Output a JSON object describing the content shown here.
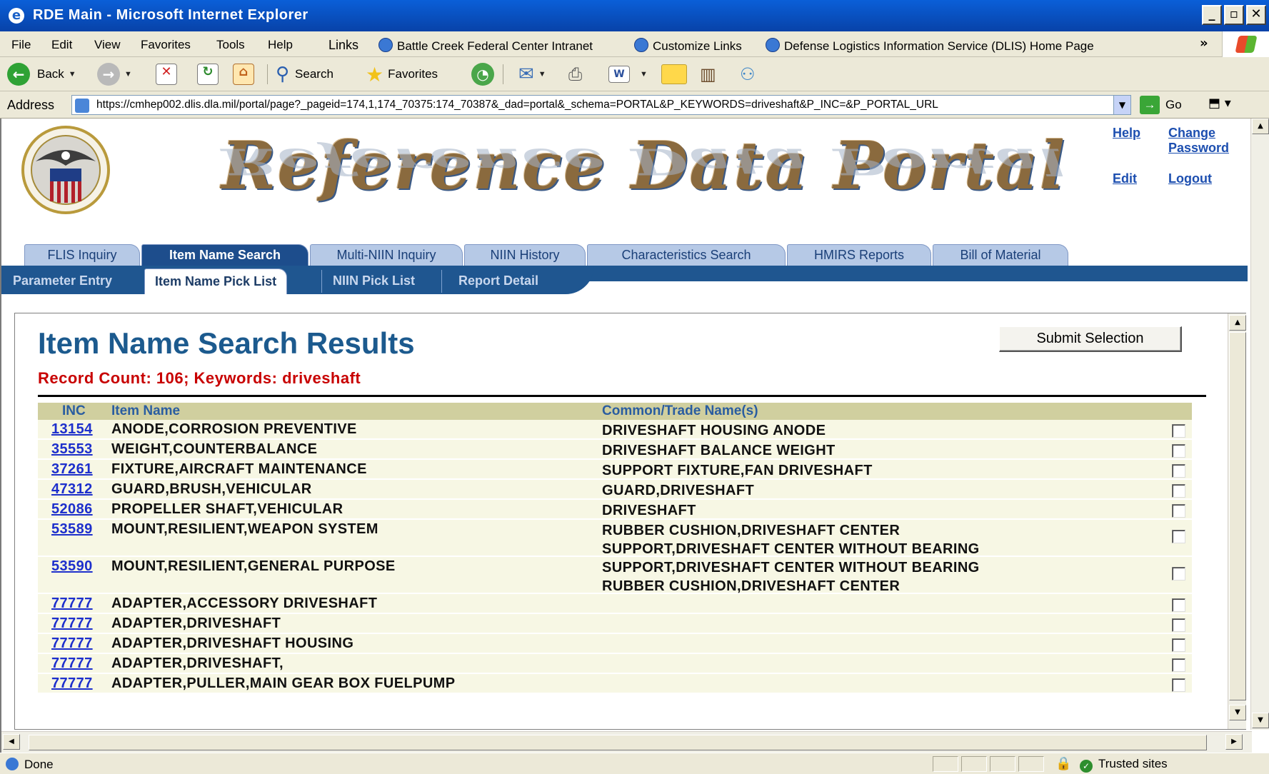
{
  "window": {
    "title": "RDE Main - Microsoft Internet Explorer",
    "minimize": "_",
    "maximize": "▫",
    "close": "✕"
  },
  "menu": {
    "items": [
      "File",
      "Edit",
      "View",
      "Favorites",
      "Tools",
      "Help"
    ],
    "links_label": "Links",
    "links": [
      "Battle Creek Federal Center Intranet",
      "Customize Links",
      "Defense Logistics Information Service (DLIS) Home Page"
    ],
    "more": "»"
  },
  "toolbar": {
    "back": "Back",
    "search": "Search",
    "favorites": "Favorites"
  },
  "address": {
    "label": "Address",
    "url": "https://cmhep002.dlis.dla.mil/portal/page?_pageid=174,1,174_70375:174_70387&_dad=portal&_schema=PORTAL&P_KEYWORDS=driveshaft&P_INC=&P_PORTAL_URL",
    "go": "Go"
  },
  "portal": {
    "banner": "Reference Data Portal",
    "links": {
      "help": "Help",
      "change_password": "Change Password",
      "edit": "Edit",
      "logout": "Logout"
    },
    "tabs": [
      "FLIS Inquiry",
      "Item Name Search",
      "Multi-NIIN Inquiry",
      "NIIN History",
      "Characteristics Search",
      "HMIRS Reports",
      "Bill of Material"
    ],
    "active_tab": "Item Name Search",
    "subtabs": [
      "Parameter Entry",
      "Item Name Pick List",
      "NIIN Pick List",
      "Report Detail"
    ],
    "active_subtab": "Item Name Pick List"
  },
  "results": {
    "title": "Item Name Search Results",
    "record_line": "Record Count: 106;  Keywords: driveshaft",
    "submit_label": "Submit Selection",
    "columns": {
      "inc": "INC",
      "item_name": "Item Name",
      "trade_name": "Common/Trade Name(s)"
    },
    "rows": [
      {
        "inc": "13154",
        "name": "ANODE,CORROSION PREVENTIVE",
        "trade": [
          "DRIVESHAFT HOUSING ANODE"
        ]
      },
      {
        "inc": "35553",
        "name": "WEIGHT,COUNTERBALANCE",
        "trade": [
          "DRIVESHAFT BALANCE WEIGHT"
        ]
      },
      {
        "inc": "37261",
        "name": "FIXTURE,AIRCRAFT MAINTENANCE",
        "trade": [
          "SUPPORT FIXTURE,FAN DRIVESHAFT"
        ]
      },
      {
        "inc": "47312",
        "name": "GUARD,BRUSH,VEHICULAR",
        "trade": [
          "GUARD,DRIVESHAFT"
        ]
      },
      {
        "inc": "52086",
        "name": "PROPELLER SHAFT,VEHICULAR",
        "trade": [
          "DRIVESHAFT"
        ]
      },
      {
        "inc": "53589",
        "name": "MOUNT,RESILIENT,WEAPON SYSTEM",
        "trade": [
          "RUBBER CUSHION,DRIVESHAFT CENTER",
          "SUPPORT,DRIVESHAFT CENTER WITHOUT BEARING"
        ]
      },
      {
        "inc": "53590",
        "name": "MOUNT,RESILIENT,GENERAL PURPOSE",
        "trade": [
          "SUPPORT,DRIVESHAFT CENTER WITHOUT BEARING",
          "RUBBER CUSHION,DRIVESHAFT CENTER"
        ]
      },
      {
        "inc": "77777",
        "name": "ADAPTER,ACCESSORY DRIVESHAFT",
        "trade": []
      },
      {
        "inc": "77777",
        "name": "ADAPTER,DRIVESHAFT",
        "trade": []
      },
      {
        "inc": "77777",
        "name": "ADAPTER,DRIVESHAFT HOUSING",
        "trade": []
      },
      {
        "inc": "77777",
        "name": "ADAPTER,DRIVESHAFT,",
        "trade": []
      },
      {
        "inc": "77777",
        "name": "ADAPTER,PULLER,MAIN GEAR BOX FUELPUMP",
        "trade": []
      }
    ]
  },
  "status": {
    "text": "Done",
    "zone": "Trusted sites"
  },
  "colors": {
    "title_blue": "#1c5a8e",
    "record_red": "#c80000",
    "tab_active": "#1d4d8c",
    "row_bg": "#f7f7e4",
    "header_bg": "#d0cf9f"
  }
}
